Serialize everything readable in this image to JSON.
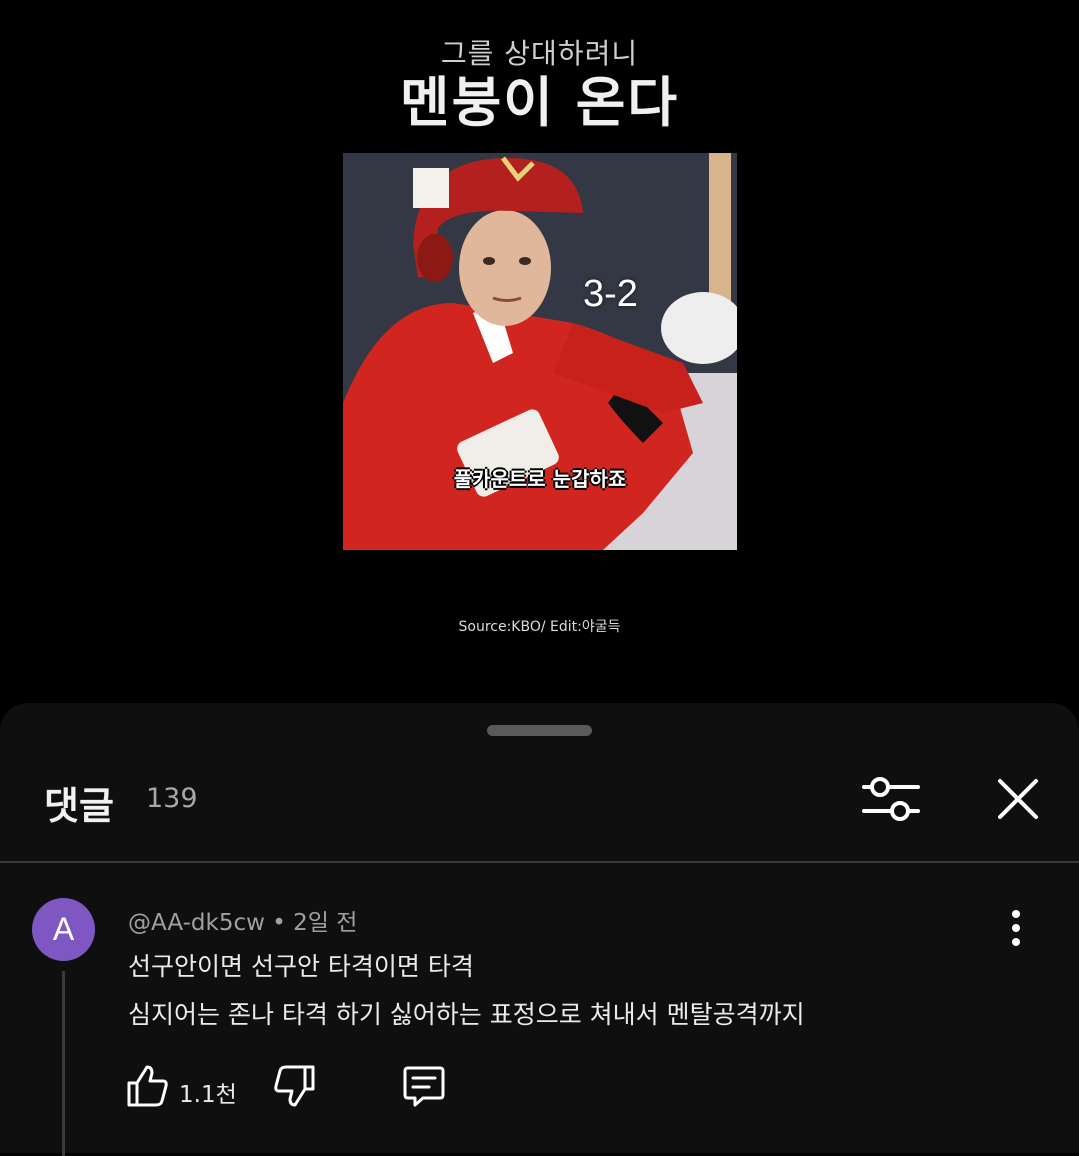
{
  "video": {
    "subtitle": "그를 상대하려니",
    "title": "멘붕이 온다",
    "count_overlay": "3-2",
    "caption_overlay": "풀카운트로 눈갑하죠",
    "source_credit": "Source:KBO/ Edit:야굴득"
  },
  "comments_panel": {
    "title": "댓글",
    "count": "139",
    "filter_icon": "sliders-icon",
    "close_icon": "close-icon"
  },
  "comment": {
    "avatar_letter": "A",
    "avatar_color": "#7e57c2",
    "author": "@AA-dk5cw",
    "separator": "•",
    "time": "2일 전",
    "line1": "선구안이면 선구안 타격이면 타격",
    "line2": "심지어는 존나 타격 하기 싫어하는 표정으로 쳐내서 멘탈공격까지",
    "likes": "1.1천"
  }
}
